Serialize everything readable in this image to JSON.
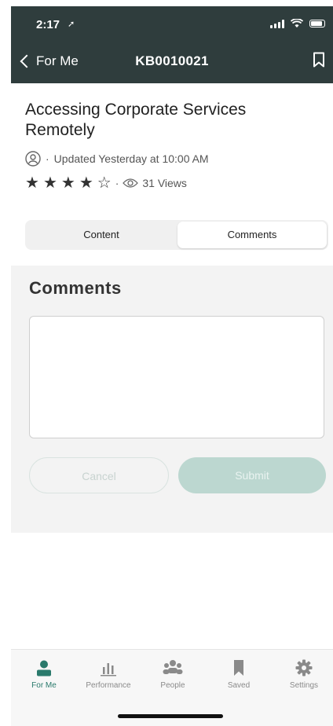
{
  "status": {
    "time": "2:17"
  },
  "nav": {
    "back_label": "For Me",
    "title": "KB0010021"
  },
  "article": {
    "title": "Accessing Corporate Services Remotely",
    "updated": "Updated Yesterday at 10:00 AM",
    "rating": {
      "value": 4,
      "max": 5
    },
    "views": "31 Views"
  },
  "segment": {
    "content_label": "Content",
    "comments_label": "Comments",
    "selected": "Comments"
  },
  "comments": {
    "heading": "Comments",
    "input_value": "",
    "cancel_label": "Cancel",
    "submit_label": "Submit"
  },
  "tabs": [
    {
      "label": "For Me",
      "icon": "person-icon",
      "active": true
    },
    {
      "label": "Performance",
      "icon": "bar-chart-icon",
      "active": false
    },
    {
      "label": "People",
      "icon": "people-icon",
      "active": false
    },
    {
      "label": "Saved",
      "icon": "bookmark-icon",
      "active": false
    },
    {
      "label": "Settings",
      "icon": "gear-icon",
      "active": false
    }
  ],
  "colors": {
    "nav": "#2f3d3d",
    "accent": "#2a7a6c",
    "submit_disabled": "#bcd7d0"
  }
}
